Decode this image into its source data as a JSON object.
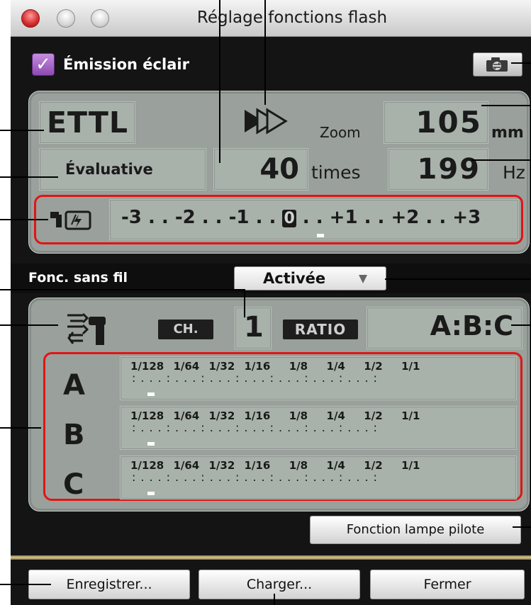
{
  "window": {
    "title": "Réglage fonctions flash"
  },
  "header": {
    "emission_label": "Émission éclair",
    "emission_checked": true
  },
  "flash": {
    "mode": "ETTL",
    "zoom_label": "Zoom",
    "zoom_value": "105",
    "zoom_unit": "mm",
    "metering": "Évaluative",
    "times_value": "40",
    "times_unit": "times",
    "hz_value": "199",
    "hz_unit": "Hz",
    "exposure_scale": [
      "-3",
      "-2",
      "-1",
      "0",
      "+1",
      "+2",
      "+3"
    ],
    "exposure_compensation": 0
  },
  "wireless": {
    "label": "Fonc. sans fil",
    "status": "Activée",
    "channel_label": "CH.",
    "channel_value": "1",
    "ratio_label": "RATIO",
    "ratio_value": "A:B:C",
    "groups": [
      {
        "letter": "A",
        "value": "1/128"
      },
      {
        "letter": "B",
        "value": "1/128"
      },
      {
        "letter": "C",
        "value": "1/128"
      }
    ],
    "power_scale": [
      "1/128",
      "1/64",
      "1/32",
      "1/16",
      "1/8",
      "1/4",
      "1/2",
      "1/1"
    ]
  },
  "buttons": {
    "modeling": "Fonction lampe pilote",
    "save": "Enregistrer...",
    "load": "Charger...",
    "close": "Fermer"
  },
  "colors": {
    "accent_red": "#e01515",
    "panel": "#9aa09b",
    "checkbox": "#9a57c0"
  }
}
